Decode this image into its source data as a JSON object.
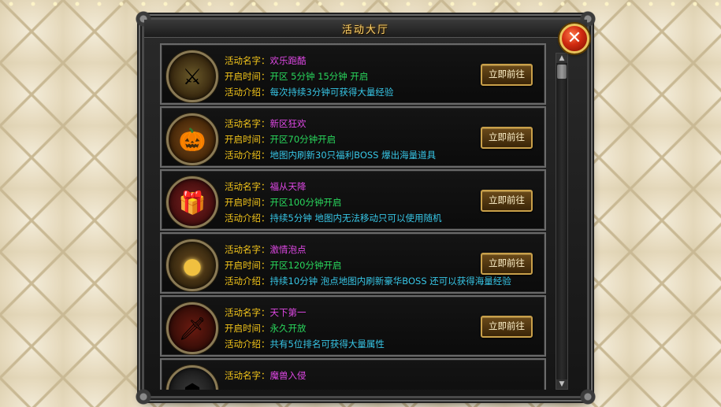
{
  "window": {
    "title": "活动大厅",
    "close_icon": "close-icon",
    "close_glyph": "✕"
  },
  "activities": [
    {
      "name_label": "活动名字：",
      "name": "欢乐跑酷",
      "time_label": "开启时间：",
      "time": "开区 5分钟 15分钟 开启",
      "desc_label": "活动介绍：",
      "desc": "每次持续3分钟可获得大量经验",
      "button": "立即前往",
      "icon": "running-warrior-icon",
      "glyph": "⚔"
    },
    {
      "name_label": "活动名字：",
      "name": "新区狂欢",
      "time_label": "开启时间：",
      "time": "开区70分钟开启",
      "desc_label": "活动介绍：",
      "desc": "地图内刷新30只福利BOSS 爆出海量道具",
      "button": "立即前往",
      "icon": "pumpkin-icon",
      "glyph": "🎃"
    },
    {
      "name_label": "活动名字：",
      "name": "福从天降",
      "time_label": "开启时间：",
      "time": "开区100分钟开启",
      "desc_label": "活动介绍：",
      "desc": "持续5分钟 地图内无法移动只可以使用随机",
      "button": "立即前往",
      "icon": "gift-box-icon",
      "glyph": "🎁"
    },
    {
      "name_label": "活动名字：",
      "name": "激情泡点",
      "time_label": "开启时间：",
      "time": "开区120分钟开启",
      "desc_label": "活动介绍：",
      "desc": "持续10分钟 泡点地图内刷新豪华BOSS 还可以获得海量经验",
      "button": "立即前往",
      "icon": "golden-orb-icon",
      "glyph": "●"
    },
    {
      "name_label": "活动名字：",
      "name": "天下第一",
      "time_label": "开启时间：",
      "time": "永久开放",
      "desc_label": "活动介绍：",
      "desc": "共有5位排名可获得大量属性",
      "button": "立即前往",
      "icon": "flaming-blade-icon",
      "glyph": "🗡"
    },
    {
      "name_label": "活动名字：",
      "name": "魔兽入侵",
      "icon": "beast-icon",
      "glyph": "☗"
    }
  ],
  "scrollbar": {
    "up_glyph": "▲",
    "down_glyph": "▼"
  },
  "colors": {
    "label": "#f3c51a",
    "name": "#e048e6",
    "time": "#29d65c",
    "desc": "#37c6e6",
    "title": "#ffd36a"
  }
}
